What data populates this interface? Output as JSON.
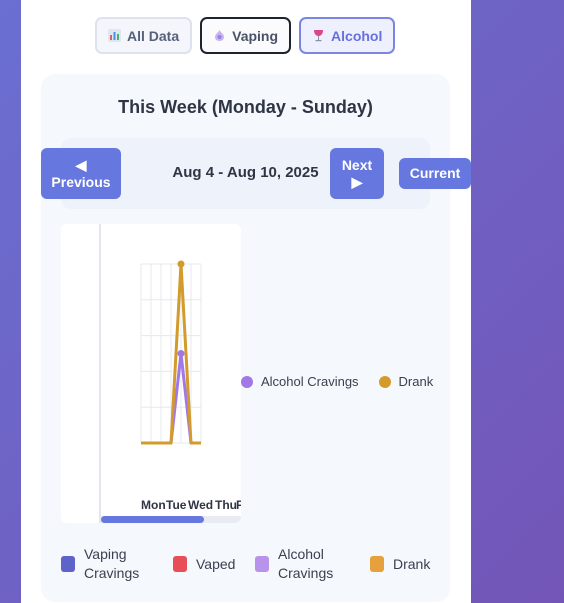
{
  "filters": [
    {
      "label": "All Data",
      "icon": "bar-chart-icon"
    },
    {
      "label": "Vaping",
      "icon": "vape-icon"
    },
    {
      "label": "Alcohol",
      "icon": "wine-glass-icon"
    }
  ],
  "week": {
    "title": "This Week (Monday - Sunday)",
    "date_range": "Aug 4 - Aug 10, 2025",
    "prev_arrow": "◀",
    "prev_label": "Previous",
    "next_label": "Next",
    "next_arrow": "▶",
    "current_label": "Current"
  },
  "chart_data": {
    "type": "line",
    "categories": [
      "Mon",
      "Tue",
      "Wed",
      "Thu",
      "F"
    ],
    "series": [
      {
        "name": "Alcohol Cravings",
        "color": "#a178e6",
        "values": [
          0,
          0,
          1,
          0,
          0
        ]
      },
      {
        "name": "Drank",
        "color": "#d39a2c",
        "values": [
          0,
          0,
          2,
          0,
          0
        ]
      }
    ],
    "ylim": [
      0,
      2
    ],
    "grid": true
  },
  "side_legend": [
    {
      "label": "Alcohol Cravings",
      "color": "#a178e6"
    },
    {
      "label": "Drank",
      "color": "#d39a2c"
    }
  ],
  "bottom_legend": [
    {
      "label": "Vaping Cravings",
      "color": "#5d63c9"
    },
    {
      "label": "Vaped",
      "color": "#e74e57"
    },
    {
      "label": "Alcohol Cravings",
      "color": "#b793ec"
    },
    {
      "label": "Drank",
      "color": "#e6a13c"
    }
  ]
}
